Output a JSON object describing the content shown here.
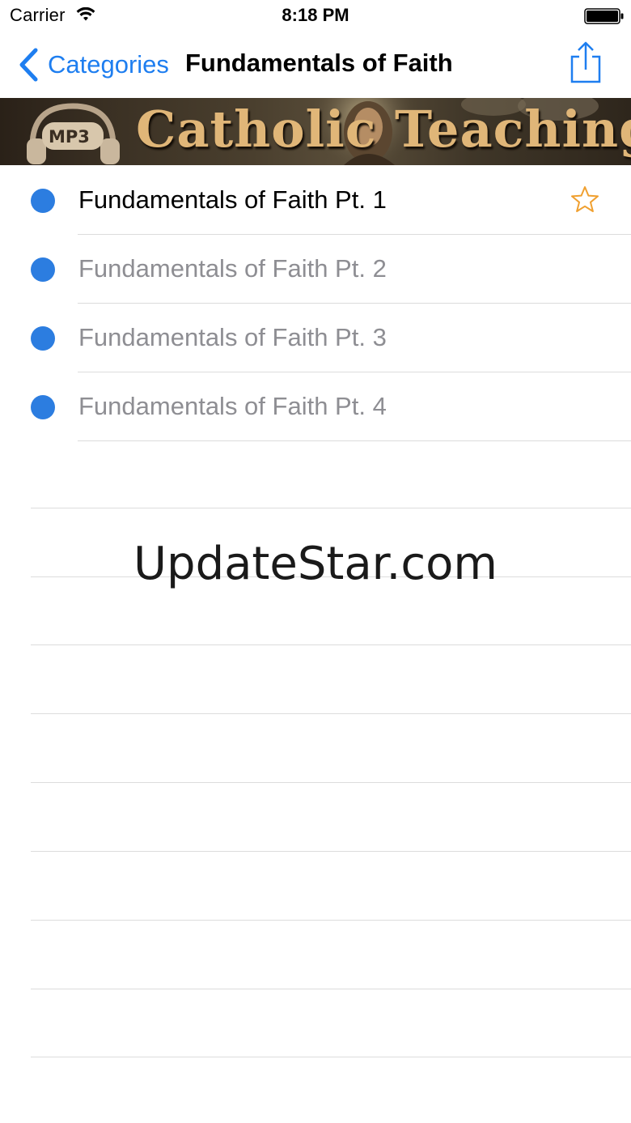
{
  "status_bar": {
    "carrier": "Carrier",
    "time": "8:18 PM",
    "wifi_icon": "wifi-icon",
    "battery_icon": "battery-icon"
  },
  "nav": {
    "back_label": "Categories",
    "back_icon": "chevron-left-icon",
    "title": "Fundamentals of Faith",
    "share_icon": "share-icon",
    "accent_color": "#1e7ef0"
  },
  "banner": {
    "title": "Catholic Teaching",
    "badge": "MP3"
  },
  "list": {
    "items": [
      {
        "label": "Fundamentals of Faith Pt. 1",
        "state": "played",
        "starred": false
      },
      {
        "label": "Fundamentals of Faith Pt. 2",
        "state": "unplayed"
      },
      {
        "label": "Fundamentals of Faith Pt. 3",
        "state": "unplayed"
      },
      {
        "label": "Fundamentals of Faith Pt. 4",
        "state": "unplayed"
      }
    ],
    "dot_color": "#2c7de0",
    "star_color": "#f0a030"
  },
  "watermark": "UpdateStar.com"
}
